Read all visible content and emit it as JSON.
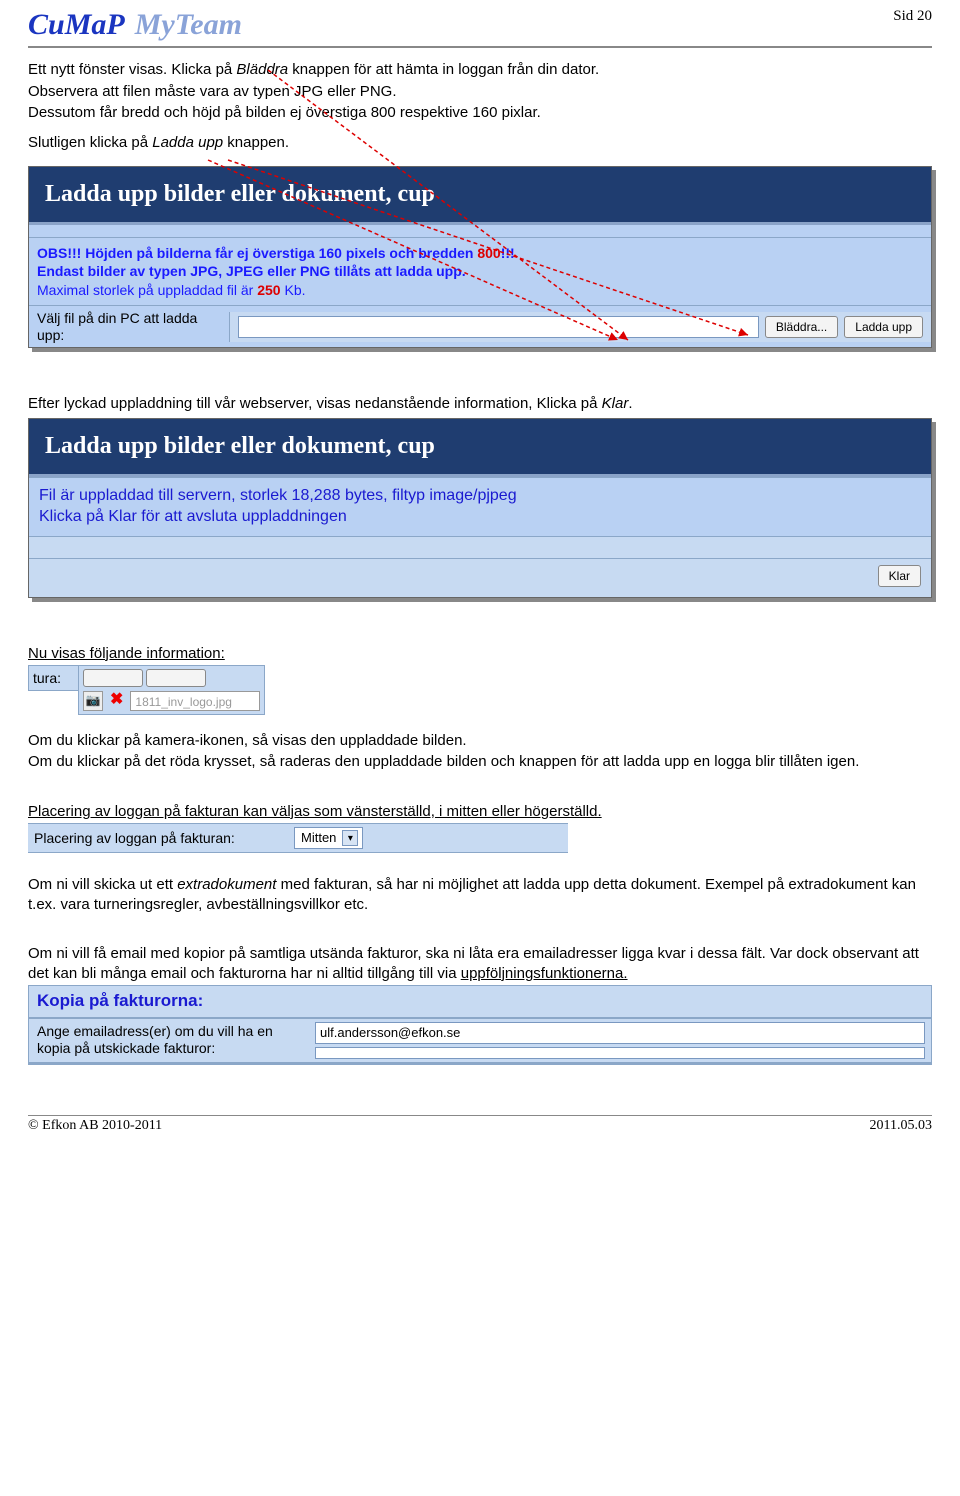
{
  "header": {
    "logo1": "CuMaP",
    "logo2": "MyTeam",
    "page_label": "Sid 20"
  },
  "intro": {
    "p1a": "Ett nytt fönster visas. Klicka på ",
    "p1_bladdra": "Bläddra",
    "p1b": " knappen för att hämta in loggan från din dator.",
    "p2": "Observera att filen måste vara av typen JPG eller PNG.",
    "p3": "Dessutom får bredd och höjd på bilden ej överstiga 800 respektive 160 pixlar.",
    "p4a": "Slutligen klicka på ",
    "p4_ladda": "Ladda upp",
    "p4b": " knappen."
  },
  "scr1": {
    "title": "Ladda upp bilder eller dokument, cup",
    "obs_prefix": "OBS!!! Höjden på bilderna får ej överstiga 160 pixels och bredden ",
    "obs_800": "800",
    "obs_suffix": "!!!",
    "line2": "Endast bilder av typen JPG, JPEG eller PNG tillåts att ladda upp.",
    "line3a": "Maximal storlek på uppladdad fil är ",
    "line3_250": "250",
    "line3b": " Kb.",
    "upload_label": "Välj fil på din PC att ladda upp:",
    "btn_browse": "Bläddra...",
    "btn_upload": "Ladda upp"
  },
  "mid1": {
    "text_a": "Efter lyckad uppladdning till vår webserver, visas nedanstående information, Klicka på ",
    "text_klar": "Klar",
    "text_b": "."
  },
  "scr2": {
    "title": "Ladda upp bilder eller dokument, cup",
    "info1": "Fil är uppladdad till servern, storlek 18,288 bytes, filtyp image/pjpeg",
    "info2": "Klicka på Klar för att avsluta uppladdningen",
    "btn_klar": "Klar"
  },
  "snippet_info": {
    "heading": "Nu visas följande information:",
    "tura": "tura:",
    "filename": "1811_inv_logo.jpg"
  },
  "after_snip": {
    "p1": "Om du klickar på kamera-ikonen, så visas den uppladdade bilden.",
    "p2": "Om du klickar på det röda krysset, så raderas den uppladdade bilden och knappen för att ladda upp en logga blir tillåten igen."
  },
  "placering": {
    "intro": "Placering av loggan på fakturan kan väljas som vänsterställd, i mitten eller högerställd.",
    "label": "Placering av loggan på fakturan:",
    "value": "Mitten"
  },
  "extra": {
    "p1a": "Om ni vill skicka ut ett ",
    "p1_em": "extradokument",
    "p1b": " med fakturan, så har ni möjlighet att ladda upp detta dokument. Exempel på extradokument kan t.ex. vara turneringsregler, avbeställningsvillkor etc."
  },
  "email": {
    "p1": "Om ni vill få email med kopior på samtliga utsända fakturor, ska ni låta era emailadresser ligga kvar i dessa fält. Var dock observant att det kan bli många email och fakturorna har ni alltid tillgång till via ",
    "p1_u": "uppföljningsfunktionerna."
  },
  "kopia": {
    "title": "Kopia på fakturorna:",
    "label": "Ange emailadress(er) om du vill ha en kopia på utskickade fakturor:",
    "value1": "ulf.andersson@efkon.se",
    "value2": ""
  },
  "footer": {
    "left": "© Efkon AB 2010-2011",
    "right": "2011.05.03"
  }
}
